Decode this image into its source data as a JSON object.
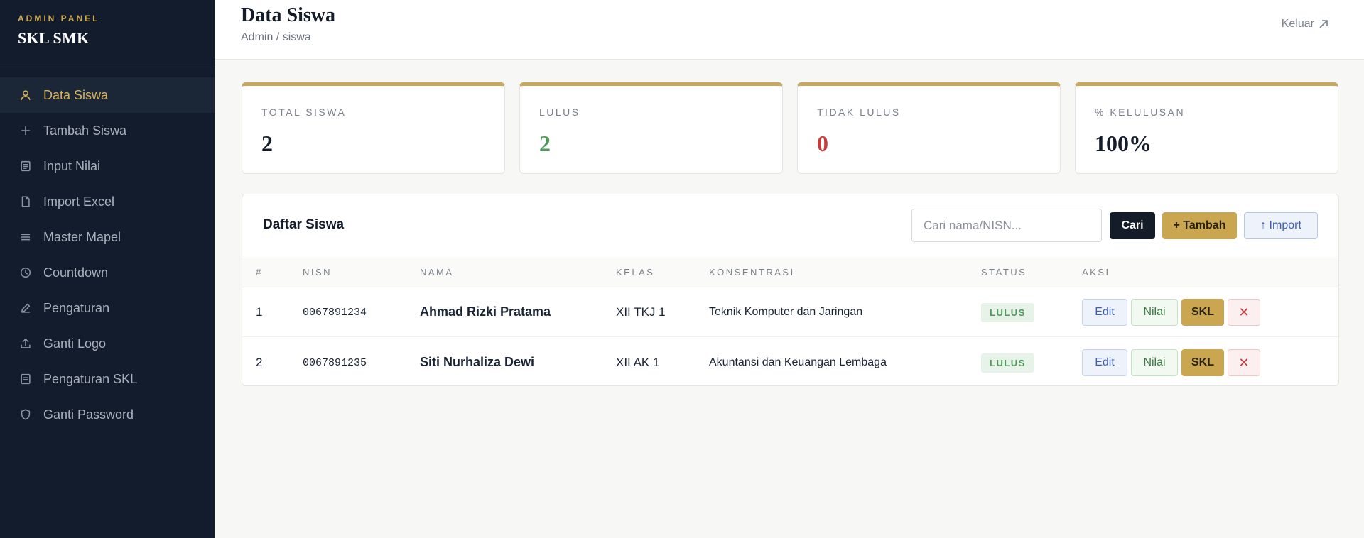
{
  "sidebar": {
    "eyebrow": "ADMIN PANEL",
    "brand": "SKL SMK",
    "items": [
      {
        "label": "Data Siswa",
        "icon": "user-icon"
      },
      {
        "label": "Tambah Siswa",
        "icon": "plus-icon"
      },
      {
        "label": "Input Nilai",
        "icon": "list-icon"
      },
      {
        "label": "Import Excel",
        "icon": "file-icon"
      },
      {
        "label": "Master Mapel",
        "icon": "menu-icon"
      },
      {
        "label": "Countdown",
        "icon": "clock-icon"
      },
      {
        "label": "Pengaturan",
        "icon": "pencil-icon"
      },
      {
        "label": "Ganti Logo",
        "icon": "upload-icon"
      },
      {
        "label": "Pengaturan SKL",
        "icon": "document-icon"
      },
      {
        "label": "Ganti Password",
        "icon": "shield-icon"
      }
    ]
  },
  "header": {
    "title": "Data Siswa",
    "breadcrumb": "Admin / siswa",
    "logout": "Keluar"
  },
  "stats": [
    {
      "label": "TOTAL SISWA",
      "value": "2"
    },
    {
      "label": "LULUS",
      "value": "2"
    },
    {
      "label": "TIDAK LULUS",
      "value": "0"
    },
    {
      "label": "% KELULUSAN",
      "value": "100%"
    }
  ],
  "table": {
    "title": "Daftar Siswa",
    "search_placeholder": "Cari nama/NISN...",
    "search_button": "Cari",
    "add_button": "+ Tambah",
    "import_button": "↑ Import",
    "columns": [
      "#",
      "NISN",
      "NAMA",
      "KELAS",
      "KONSENTRASI",
      "STATUS",
      "AKSI"
    ],
    "rows": [
      {
        "no": "1",
        "nisn": "0067891234",
        "nama": "Ahmad Rizki Pratama",
        "kelas": "XII TKJ 1",
        "konsentrasi": "Teknik Komputer dan Jaringan",
        "status": "LULUS"
      },
      {
        "no": "2",
        "nisn": "0067891235",
        "nama": "Siti Nurhaliza Dewi",
        "kelas": "XII AK 1",
        "konsentrasi": "Akuntansi dan Keuangan Lembaga",
        "status": "LULUS"
      }
    ],
    "actions": {
      "edit": "Edit",
      "nilai": "Nilai",
      "skl": "SKL",
      "delete": "✕"
    }
  },
  "colors": {
    "sidebar_bg": "#121c2c",
    "accent_gold": "#c9a64f",
    "success_green": "#4f9a5a",
    "danger_red": "#c43c3c"
  }
}
